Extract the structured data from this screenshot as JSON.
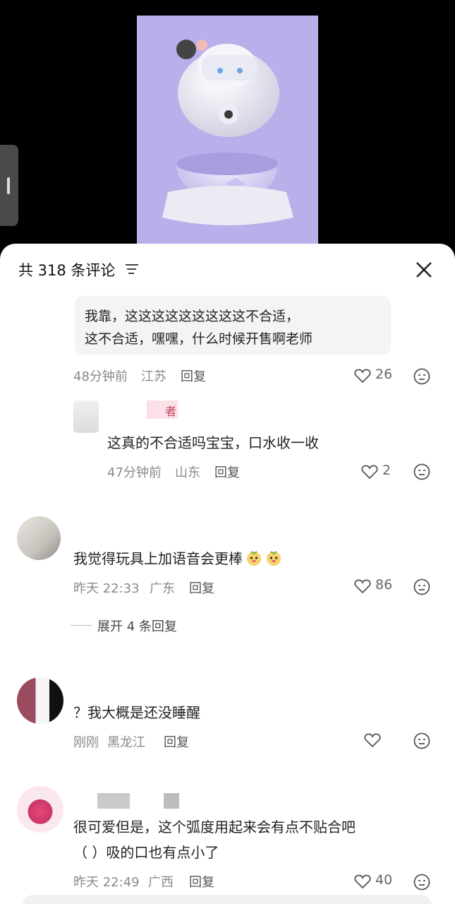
{
  "header": {
    "title": "共 318 条评论"
  },
  "comments": [
    {
      "text_lines": [
        "我靠，这这这这这这这这这不合适，",
        "这不合适，嘿嘿，什么时候开售啊老师"
      ],
      "time": "48分钟前",
      "location": "江苏",
      "reply_label": "回复",
      "likes": "26"
    },
    {
      "author_badge": "者",
      "text": "这真的不合适吗宝宝，口水收一收",
      "time": "47分钟前",
      "location": "山东",
      "reply_label": "回复",
      "likes": "2"
    },
    {
      "text": "我觉得玩具上加语音会更棒",
      "time": "昨天 22:33",
      "location": "广东",
      "reply_label": "回复",
      "likes": "86",
      "expand_label": "展开 4 条回复"
    },
    {
      "text": "？我大概是还没睡醒",
      "time": "刚刚",
      "location": "黑龙江",
      "reply_label": "回复"
    },
    {
      "text_lines": [
        "很可爱但是，这个弧度用起来会有点不贴合吧",
        "（ ）吸的口也有点小了"
      ],
      "time": "昨天 22:49",
      "location": "广西",
      "reply_label": "回复",
      "likes": "40"
    }
  ],
  "colors": {
    "photo_bg": "#b7b0ea",
    "sheet_bg": "#ffffff",
    "bubble_bg": "#f4f4f4"
  },
  "icons": [
    "filter-icon",
    "close-icon",
    "heart-icon",
    "dislike-icon",
    "emoji-icon"
  ]
}
